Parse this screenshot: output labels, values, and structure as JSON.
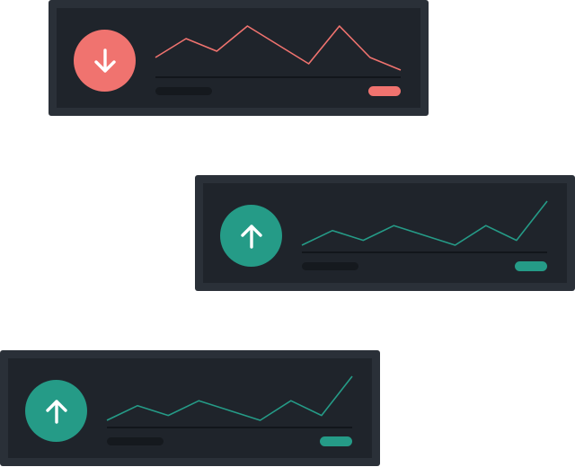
{
  "colors": {
    "card_frame": "#2a3038",
    "card_body": "#1f242b",
    "baseline": "#0f1216",
    "skeleton": "#15191e",
    "down": "#f0736f",
    "up": "#259b87",
    "arrow": "#ffffff"
  },
  "cards": [
    {
      "trend": "down",
      "icon": "arrow-down-icon",
      "series": [
        2,
        5,
        3,
        7,
        4,
        1,
        7,
        2,
        0
      ]
    },
    {
      "trend": "up",
      "icon": "arrow-up-icon",
      "series": [
        2,
        5,
        3,
        6,
        4,
        2,
        6,
        3,
        11
      ]
    },
    {
      "trend": "up",
      "icon": "arrow-up-icon",
      "series": [
        2,
        5,
        3,
        6,
        4,
        2,
        6,
        3,
        11
      ]
    }
  ]
}
